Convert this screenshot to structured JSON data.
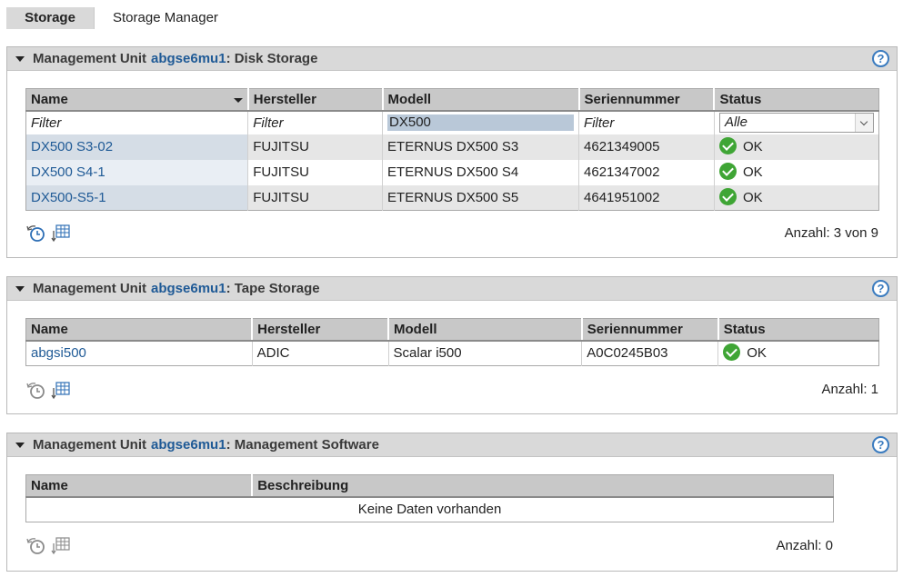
{
  "tabs": [
    {
      "label": "Storage",
      "active": true
    },
    {
      "label": "Storage Manager",
      "active": false
    }
  ],
  "panels": {
    "disk": {
      "prefix": "Management Unit",
      "unit": "abgse6mu1",
      "suffix": ": Disk Storage",
      "columns": [
        "Name",
        "Hersteller",
        "Modell",
        "Seriennummer",
        "Status"
      ],
      "filters": {
        "name": "Filter",
        "hersteller": "Filter",
        "modell": "DX500",
        "serien": "Filter",
        "status": "Alle"
      },
      "rows": [
        {
          "name": "DX500 S3-02",
          "hersteller": "FUJITSU",
          "modell": "ETERNUS DX500 S3",
          "serien": "4621349005",
          "status": "OK"
        },
        {
          "name": "DX500 S4-1",
          "hersteller": "FUJITSU",
          "modell": "ETERNUS DX500 S4",
          "serien": "4621347002",
          "status": "OK"
        },
        {
          "name": "DX500-S5-1",
          "hersteller": "FUJITSU",
          "modell": "ETERNUS DX500 S5",
          "serien": "4641951002",
          "status": "OK"
        }
      ],
      "count": "Anzahl: 3 von 9"
    },
    "tape": {
      "prefix": "Management Unit",
      "unit": "abgse6mu1",
      "suffix": ": Tape Storage",
      "columns": [
        "Name",
        "Hersteller",
        "Modell",
        "Seriennummer",
        "Status"
      ],
      "rows": [
        {
          "name": "abgsi500",
          "hersteller": "ADIC",
          "modell": "Scalar i500",
          "serien": "A0C0245B03",
          "status": "OK"
        }
      ],
      "count": "Anzahl: 1"
    },
    "software": {
      "prefix": "Management Unit",
      "unit": "abgse6mu1",
      "suffix": ": Management Software",
      "columns": [
        "Name",
        "Beschreibung"
      ],
      "empty": "Keine Daten vorhanden",
      "count": "Anzahl: 0"
    }
  },
  "help_label": "?",
  "colors": {
    "link": "#1f5a96",
    "header": "#d9d9d9",
    "ok": "#3fa535",
    "help": "#3a7bbf"
  },
  "icons": {
    "collapse": "triangle-down-icon",
    "refresh": "history-refresh-icon",
    "export": "table-export-icon",
    "status_ok": "checkmark-circle-icon",
    "help": "question-circle-icon"
  }
}
